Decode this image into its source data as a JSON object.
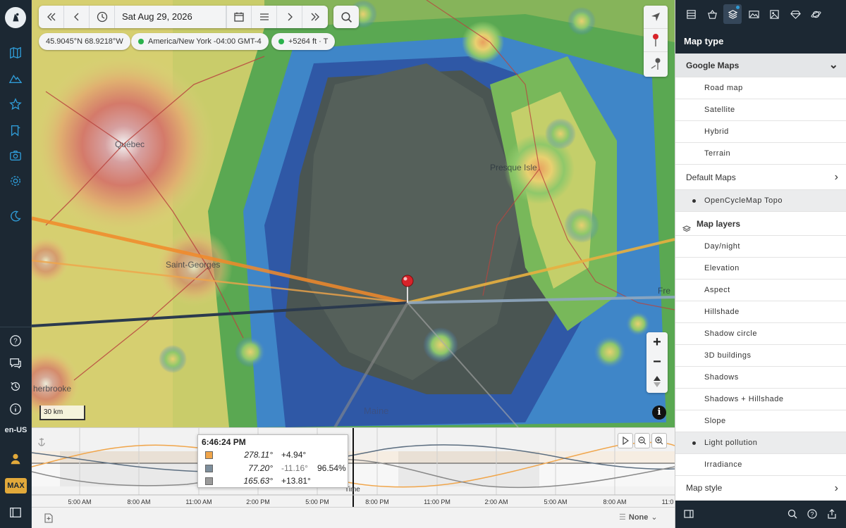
{
  "toolbar": {
    "date": "Sat Aug 29, 2026"
  },
  "status": {
    "coords": "45.9045°N 68.9218°W",
    "timezone": "America/New York -04:00 GMT-4",
    "elevation": "+5264 ft · T"
  },
  "map": {
    "labels": {
      "quebec": "Québec",
      "presque_isle": "Presque Isle",
      "saint_georges": "Saint-Georges",
      "sherbrooke": "herbrooke",
      "maine": "Maine",
      "fred": "Fre"
    },
    "scale": "30 km"
  },
  "sidebar": {
    "locale": "en-US",
    "max": "MAX"
  },
  "timeline": {
    "tooltip": {
      "time": "6:46:24 PM",
      "rows": [
        {
          "color": "#f0a54a",
          "azimuth": "278.11°",
          "elevation": "+4.94°"
        },
        {
          "color": "#7d8e9c",
          "azimuth": "77.20°",
          "elevation": "-11.16°"
        },
        {
          "color": "#9a9a9a",
          "azimuth": "165.63°",
          "elevation": "+13.81°"
        }
      ],
      "percent": "96.54%"
    },
    "time_axis": "Time",
    "ticks": [
      "5:00 AM",
      "8:00 AM",
      "11:00 AM",
      "2:00 PM",
      "5:00 PM",
      "8:00 PM",
      "11:00 PM",
      "2:00 AM",
      "5:00 AM",
      "8:00 AM",
      "11:0"
    ],
    "select": "None"
  },
  "panel": {
    "title": "Map type",
    "google_maps": "Google Maps",
    "google_items": [
      "Road map",
      "Satellite",
      "Hybrid",
      "Terrain"
    ],
    "default_maps": "Default Maps",
    "default_selected": "OpenCycleMap Topo",
    "map_layers": "Map layers",
    "layers": [
      "Day/night",
      "Elevation",
      "Aspect",
      "Hillshade",
      "Shadow circle",
      "3D buildings",
      "Shadows",
      "Shadows + Hillshade",
      "Slope",
      "Light pollution",
      "Irradiance"
    ],
    "map_style": "Map style"
  },
  "colors": {
    "sun": "#f0a54a",
    "moon": "#7d8e9c",
    "accent": "#e2a93a"
  }
}
